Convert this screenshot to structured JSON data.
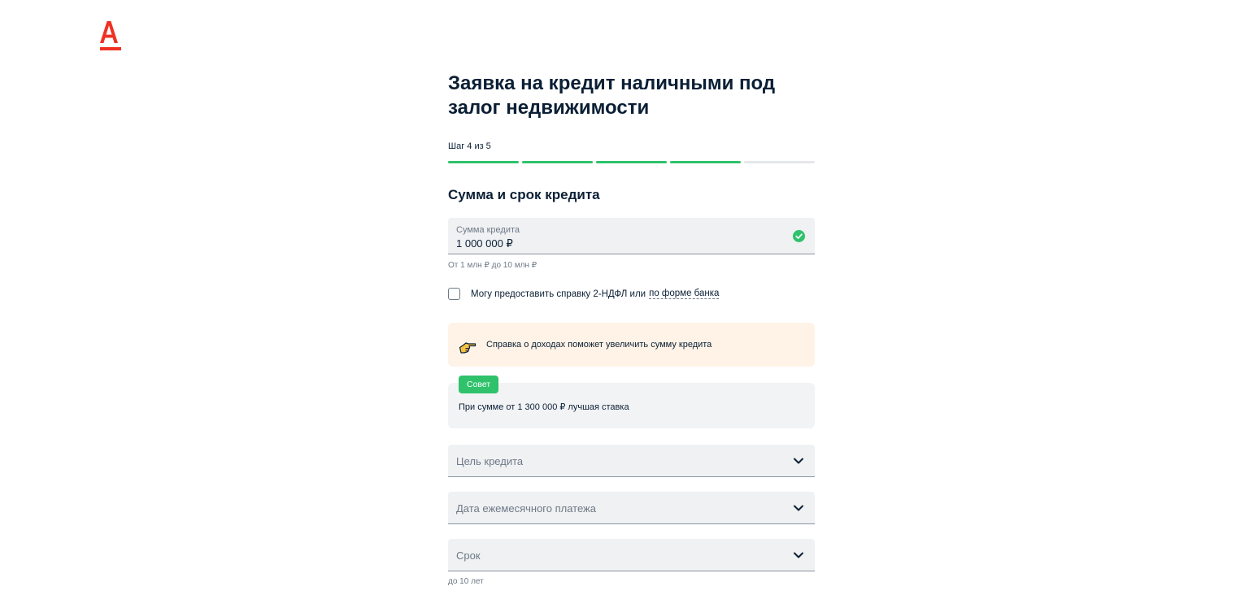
{
  "brand": {
    "logo_icon": "alfa-bank-logo-icon",
    "logo_color": "#ef3124"
  },
  "page": {
    "title": "Заявка на кредит наличными под залог недвижимости"
  },
  "progress": {
    "step_label": "Шаг 4 из 5",
    "current_step": 4,
    "total_steps": 5,
    "done_color": "#2fc26b"
  },
  "section": {
    "title": "Сумма и срок кредита"
  },
  "amount": {
    "label": "Сумма кредита",
    "value": "1 000 000 ₽",
    "hint": "От 1 млн ₽ до 10 млн ₽",
    "status_icon": "check-circle-icon"
  },
  "income_checkbox": {
    "label": "Могу предоставить справку 2-НДФЛ или",
    "link": "по форме банка",
    "checked": false
  },
  "info": {
    "icon": "pointing-hand-icon",
    "text": "Справка о доходах поможет увеличить сумму кредита"
  },
  "tip": {
    "badge": "Совет",
    "text": "При сумме от 1 300 000 ₽ лучшая ставка"
  },
  "selects": {
    "purpose": {
      "placeholder": "Цель кредита"
    },
    "payment_date": {
      "placeholder": "Дата ежемесячного платежа"
    },
    "term": {
      "placeholder": "Срок",
      "hint": "до 10 лет"
    }
  }
}
